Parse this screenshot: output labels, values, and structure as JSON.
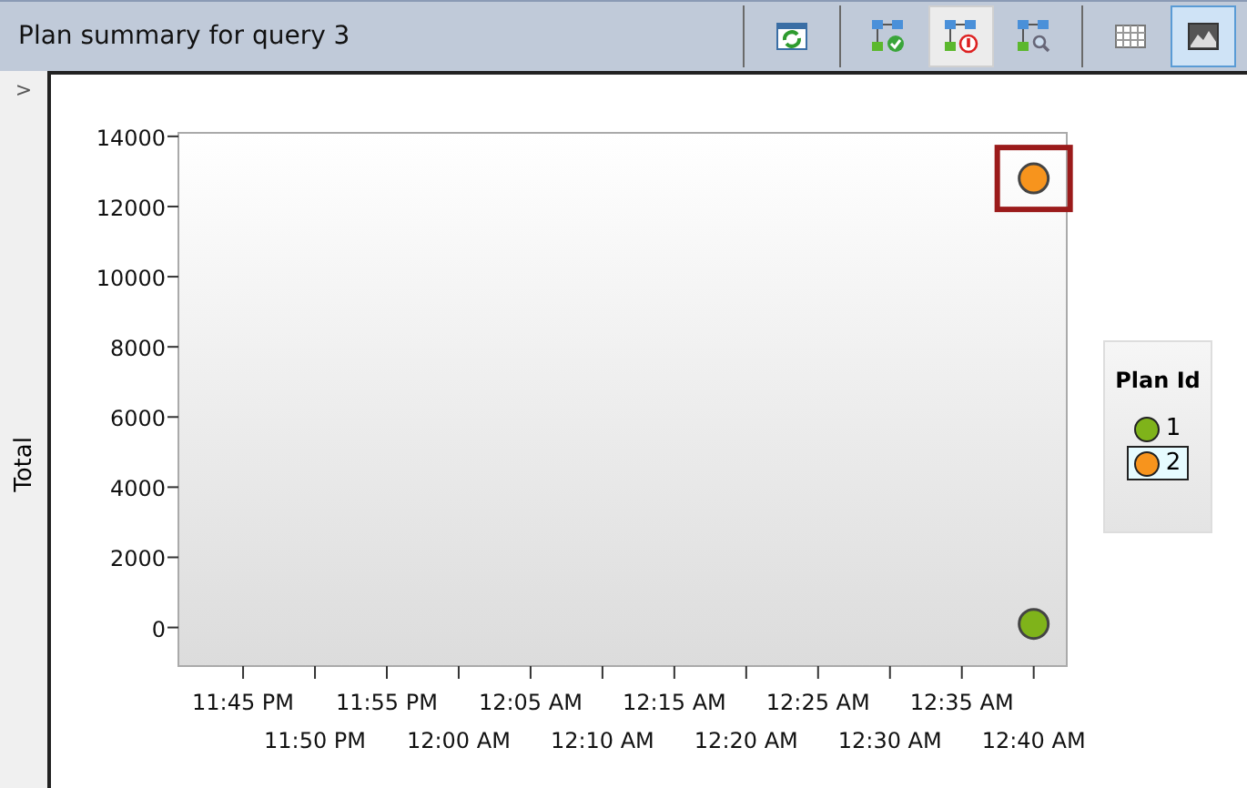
{
  "title": "Plan summary for query 3",
  "toolbar": [
    {
      "kind": "refresh",
      "selected": false
    },
    {
      "kind": "force",
      "selected": false
    },
    {
      "kind": "unforce",
      "selected": true
    },
    {
      "kind": "compare",
      "selected": false
    },
    {
      "kind": "grid",
      "selected": false
    },
    {
      "kind": "chart",
      "selected": true
    }
  ],
  "side_toggle": ">",
  "chart_data": {
    "type": "scatter",
    "ylabel": "Total",
    "ylim": [
      -1100,
      14100
    ],
    "categories": [
      "11:45 PM",
      "11:50 PM",
      "11:55 PM",
      "12:00 AM",
      "12:05 AM",
      "12:10 AM",
      "12:15 AM",
      "12:20 AM",
      "12:25 AM",
      "12:30 AM",
      "12:35 AM",
      "12:40 AM"
    ],
    "yticks": [
      {
        "value": 0,
        "label": "0"
      },
      {
        "value": 2000,
        "label": "2000"
      },
      {
        "value": 4000,
        "label": "4000"
      },
      {
        "value": 6000,
        "label": "6000"
      },
      {
        "value": 8000,
        "label": "8000"
      },
      {
        "value": 10000,
        "label": "10000"
      },
      {
        "value": 12000,
        "label": "12000"
      },
      {
        "value": 14000,
        "label": "14000"
      }
    ],
    "series": [
      {
        "name": "1",
        "color": "#7fb31a",
        "values": [
          null,
          null,
          null,
          null,
          null,
          null,
          null,
          null,
          null,
          null,
          null,
          100
        ]
      },
      {
        "name": "2",
        "color": "#f7941d",
        "values": [
          null,
          null,
          null,
          null,
          null,
          null,
          null,
          null,
          null,
          null,
          null,
          12800
        ]
      }
    ]
  },
  "legend": {
    "title": "Plan Id",
    "items": [
      {
        "selected": false
      },
      {
        "selected": true
      }
    ]
  }
}
